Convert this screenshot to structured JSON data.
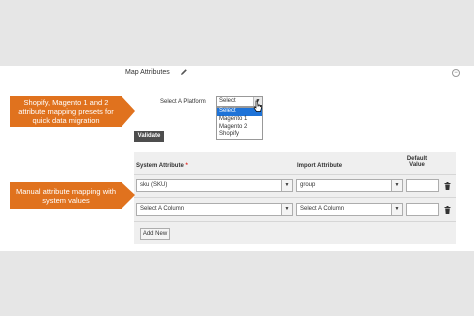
{
  "section": {
    "title": "Map Attributes",
    "collapse_symbol": "−"
  },
  "platform": {
    "label": "Select A Platform",
    "current": "Select",
    "options": [
      "Select",
      "Magento 1",
      "Magento 2",
      "Shopify"
    ],
    "highlighted_option": "Select"
  },
  "validate_label": "Validate",
  "table": {
    "headers": {
      "system": "System Attribute",
      "required_mark": "*",
      "import": "Import Attribute",
      "default_line1": "Default",
      "default_line2": "Value"
    },
    "rows": [
      {
        "system": "sku (SKU)",
        "import": "group",
        "default": ""
      },
      {
        "system": "Select A Column",
        "import": "Select A Column",
        "default": ""
      }
    ]
  },
  "add_new_label": "Add New",
  "callouts": {
    "presets": "Shopify, Magento 1 and 2 attribute mapping presets for quick data migration",
    "manual": "Manual attribute mapping with system values"
  },
  "colors": {
    "callout": "#e0721e",
    "button_dark": "#4d4d4d",
    "selection": "#1e73d8",
    "required": "#e02b27"
  },
  "icons": [
    "pencil-icon",
    "collapse-icon",
    "dropdown-arrow-icon",
    "mouse-cursor-icon",
    "trash-icon"
  ]
}
